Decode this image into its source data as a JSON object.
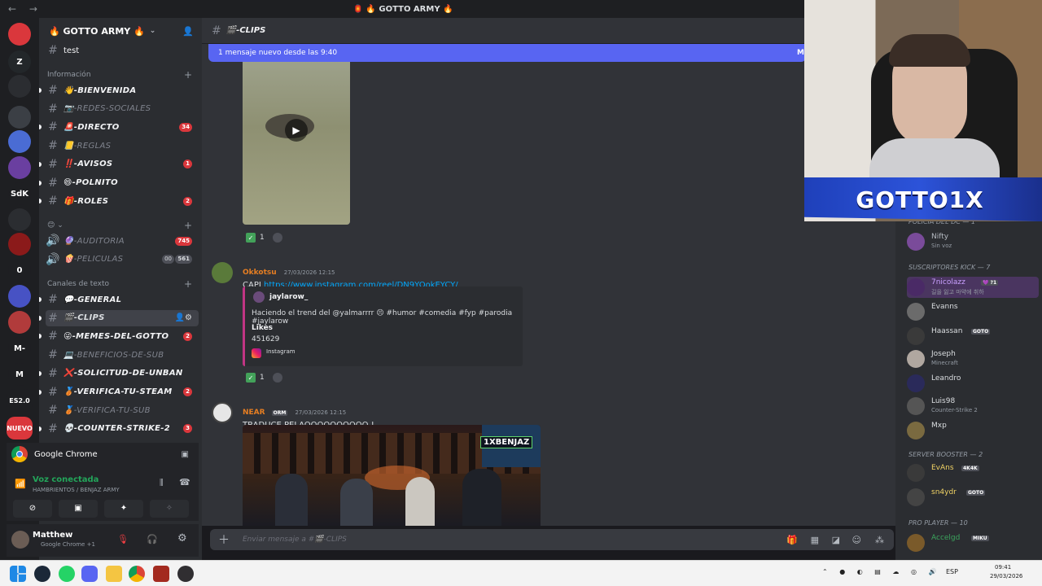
{
  "titlebar": {
    "nav": "← →",
    "title": "🏮 🔥 GOTTO ARMY 🔥"
  },
  "rail": {
    "servers": [
      {
        "label": "",
        "badge": "696",
        "color": "#da373c"
      },
      {
        "label": "Z",
        "badge": "18",
        "color": "#23272a"
      },
      {
        "label": "",
        "badge": "",
        "color": "#2b2d31"
      },
      {
        "label": "",
        "badge": "324",
        "color": "#3b3f45"
      },
      {
        "label": "",
        "badge": "1",
        "color": "#4a6cd4"
      },
      {
        "label": "",
        "badge": "230",
        "color": "#6a3fa0"
      },
      {
        "label": "SdK",
        "badge": "",
        "color": "#1e1f22"
      },
      {
        "label": "",
        "badge": "",
        "color": "#2b2d31"
      },
      {
        "label": "",
        "badge": "1",
        "color": "#8b1a1a"
      },
      {
        "label": "0",
        "badge": "",
        "color": "#1e1f22"
      },
      {
        "label": "",
        "badge": "",
        "color": "#4752c4"
      },
      {
        "label": "",
        "badge": "806",
        "color": "#b13b3b"
      },
      {
        "label": "M-",
        "badge": "",
        "color": "#1e1f22"
      },
      {
        "label": "M",
        "badge": "",
        "color": "#1e1f22"
      },
      {
        "label": "ES2.0",
        "badge": "",
        "color": "#1e1f22"
      },
      {
        "label": "NUEVO",
        "badge": "",
        "color": "#da373c"
      }
    ]
  },
  "sidebar": {
    "guild_name": "🔥 GOTTO ARMY 🔥",
    "top_channel": "test",
    "categories": [
      {
        "name": "Información"
      },
      {
        "name": "😊 ⌄"
      },
      {
        "name": "Canales de texto"
      }
    ],
    "info_channels": [
      {
        "name": "👋-BIENVENIDA",
        "badge": "",
        "state": "unread"
      },
      {
        "name": "📷-REDES-SOCIALES",
        "badge": "",
        "state": "muted"
      },
      {
        "name": "🚨-DIRECTO",
        "badge": "34",
        "state": "unread"
      },
      {
        "name": "📒-REGLAS",
        "badge": "",
        "state": "muted"
      },
      {
        "name": "‼️-AVISOS",
        "badge": "1",
        "state": "unread"
      },
      {
        "name": "😄-POLNITO",
        "badge": "",
        "state": "unread"
      },
      {
        "name": "🎁-ROLES",
        "badge": "2",
        "state": "unread"
      }
    ],
    "voice_channels": [
      {
        "name": "🔮-AUDITORIA",
        "badge": "745"
      },
      {
        "name": "🍿-PELICULAS",
        "badge": "561",
        "extra": "00"
      }
    ],
    "text_channels": [
      {
        "name": "💬-GENERAL",
        "badge": "",
        "state": "unread"
      },
      {
        "name": "🎬-CLIPS",
        "badge": "",
        "state": "active"
      },
      {
        "name": "😜-MEMES-DEL-GOTTO",
        "badge": "2",
        "state": "unread"
      },
      {
        "name": "💻-BENEFICIOS-DE-SUB",
        "badge": "",
        "state": "muted"
      },
      {
        "name": "❌-SOLICITUD-DE-UNBAN",
        "badge": "",
        "state": "unread"
      },
      {
        "name": "🥉-VERIFICA-TU-STEAM",
        "badge": "2",
        "state": "unread"
      },
      {
        "name": "🥉-VERIFICA-TU-SUB",
        "badge": "",
        "state": "muted"
      },
      {
        "name": "💀-COUNTER-STRIKE-2",
        "badge": "3",
        "state": "unread"
      }
    ]
  },
  "chrome_panel": {
    "label": "Google Chrome"
  },
  "voice": {
    "status": "Voz conectada",
    "channel": "HAMBRIENTOS / BENJAZ ARMY"
  },
  "user": {
    "name": "Matthew",
    "status": "Google Chrome +1"
  },
  "chat": {
    "channel": "🎬-CLIPS",
    "new_messages": "1 mensaje nuevo desde las 9:40",
    "new_messages_action": "M",
    "reaction1": {
      "count": "1"
    },
    "message1": {
      "author": "Okkotsu",
      "timestamp": "27/03/2026 12:15",
      "prefix": "CAPI",
      "link": "https://www.instagram.com/reel/DN9YOokEYCY/"
    },
    "embed": {
      "author": "jaylarow_",
      "description": "Haciendo el trend del @yalmarrrr 😣 #humor #comedia #fyp #parodia #jaylarow",
      "field_name": "Likes",
      "field_value": "451629",
      "footer": "Instagram"
    },
    "reaction2": {
      "count": "1"
    },
    "message2": {
      "author": "NEAR",
      "role_tag": "ORM",
      "timestamp": "27/03/2026 12:15",
      "text": "TRADUCE PELAOOOOOOOOOO !",
      "overlay": "1XBENJAZ"
    },
    "composer_placeholder": "Enviar mensaje a #🎬-CLIPS"
  },
  "members": {
    "webcam_name": "GOTTO1X",
    "groups": [
      {
        "name": "POLICIA DEL DC — 1"
      },
      {
        "name": "SUSCRIPTORES KICK — 7"
      },
      {
        "name": "SERVER BOOSTER — 2"
      },
      {
        "name": "PRO PLAYER — 10"
      }
    ],
    "list": [
      {
        "name": "Nifty",
        "sub": "Sin voz",
        "tag": "",
        "color": "#b5bac1"
      },
      {
        "name": "7nicolazz",
        "sub": "길을 잃고 마약에 취하",
        "tag": "💜 ?1",
        "color": "#c9a0ff"
      },
      {
        "name": "Evanns",
        "sub": "",
        "tag": "",
        "color": "#dbdee1"
      },
      {
        "name": "Haassan",
        "sub": "",
        "tag": "GOTO",
        "color": "#dbdee1"
      },
      {
        "name": "Joseph",
        "sub": "Minecraft",
        "tag": "",
        "color": "#dbdee1"
      },
      {
        "name": "Leandro",
        "sub": "",
        "tag": "",
        "color": "#dbdee1"
      },
      {
        "name": "Luis98",
        "sub": "Counter-Strike 2",
        "tag": "",
        "color": "#dbdee1"
      },
      {
        "name": "Mxp",
        "sub": "",
        "tag": "",
        "color": "#dbdee1"
      },
      {
        "name": "EvAns",
        "sub": "",
        "tag": "4K4K",
        "color": "#f0d264"
      },
      {
        "name": "sn4ydr",
        "sub": "",
        "tag": "GOTO",
        "color": "#f0d264"
      },
      {
        "name": "Accelgd",
        "sub": "",
        "tag": "MIKU",
        "color": "#3ba55d"
      }
    ]
  },
  "taskbar": {
    "lang": "ESP",
    "time": "09:41",
    "date": "29/03/2026"
  }
}
